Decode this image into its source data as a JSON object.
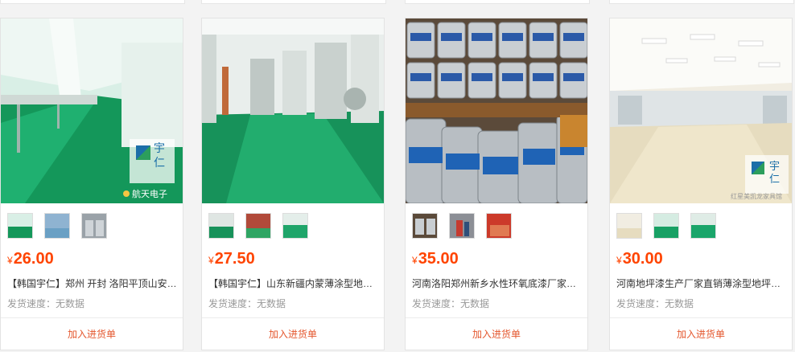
{
  "products": [
    {
      "currency": "¥",
      "price": "26.00",
      "title": "【韩国宇仁】郑州 开封 洛阳平顶山安阳环氧树脂地坪漆",
      "speed": "发货速度：无数据",
      "add_label": "加入进货单",
      "logo": "宇仁",
      "watermark": "航天电子",
      "image_theme": "green-factory-floor"
    },
    {
      "currency": "¥",
      "price": "27.50",
      "title": "【韩国宇仁】山东新疆内蒙薄涂型地坪漆环氧地坪漆",
      "speed": "发货速度：无数据",
      "add_label": "加入进货单",
      "image_theme": "green-cleanroom-floor"
    },
    {
      "currency": "¥",
      "price": "35.00",
      "title": "河南洛阳郑州新乡水性环氧底漆厂家直销地坪漆",
      "speed": "发货速度：无数据",
      "add_label": "加入进货单",
      "image_theme": "paint-buckets"
    },
    {
      "currency": "¥",
      "price": "30.00",
      "title": "河南地坪漆生产厂家直销薄涂型地坪漆环氧树脂",
      "speed": "发货速度：无数据",
      "add_label": "加入进货单",
      "logo": "宇仁",
      "watermark": "红星美凯龙家具馆",
      "image_theme": "beige-hall-floor"
    }
  ],
  "colors": {
    "price": "#ff4400",
    "add_button": "#e4572e",
    "floor_green": "#1a9a5a"
  }
}
